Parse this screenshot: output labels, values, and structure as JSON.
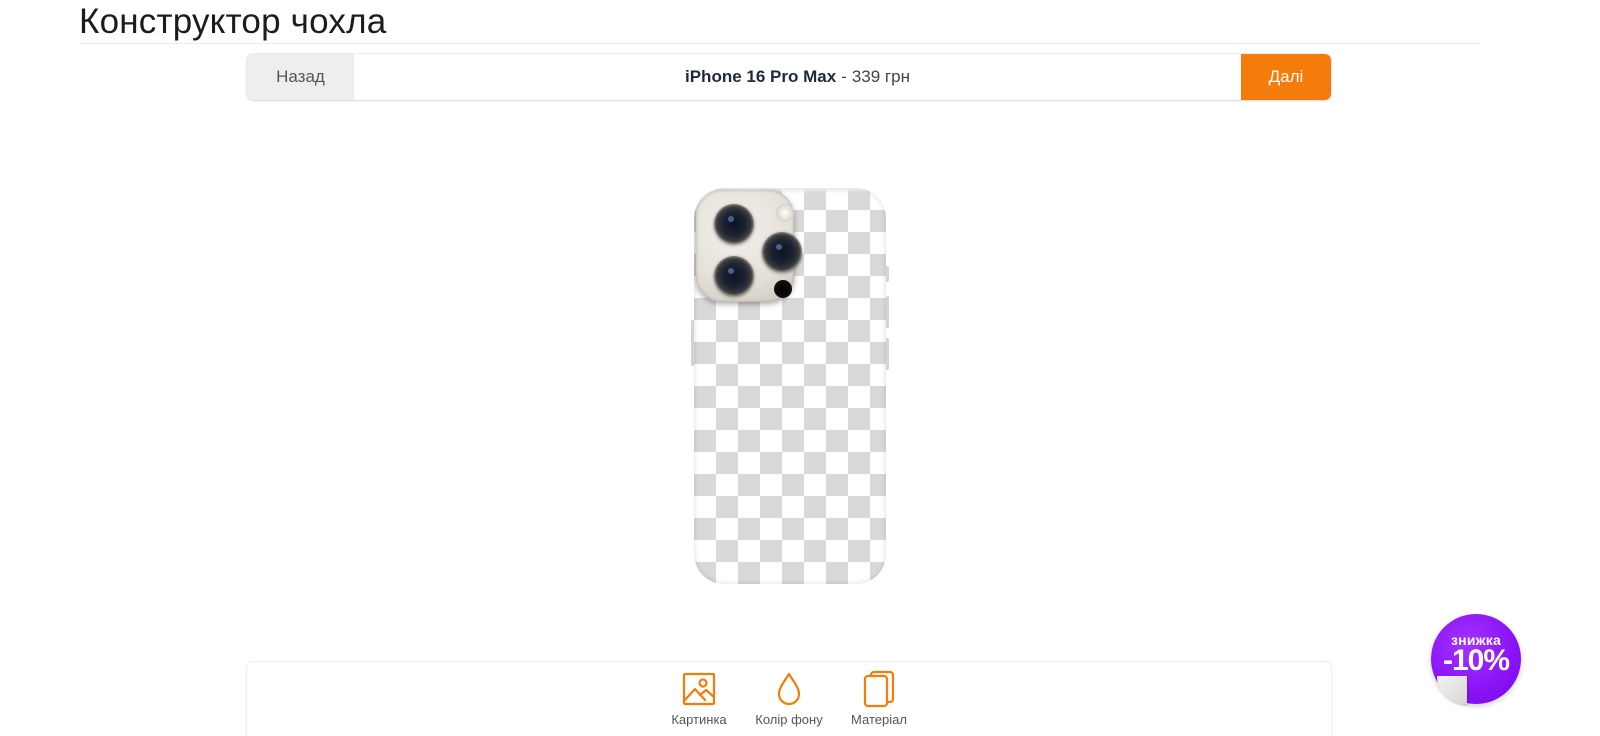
{
  "page": {
    "title": "Конструктор чохла"
  },
  "step_bar": {
    "back_label": "Назад",
    "product_model": "iPhone 16 Pro Max",
    "separator": "-",
    "price": "339 грн",
    "next_label": "Далі"
  },
  "preview": {
    "device": "iPhone 16 Pro Max",
    "background": "transparent-checkerboard"
  },
  "toolbar": {
    "items": [
      {
        "label": "Картинка",
        "icon": "image-icon"
      },
      {
        "label": "Колір фону",
        "icon": "droplet-icon"
      },
      {
        "label": "Матеріал",
        "icon": "layers-icon"
      }
    ]
  },
  "promo": {
    "label": "знижка",
    "value": "-10%"
  },
  "colors": {
    "accent": "#f47c0a",
    "promo": "#8a12f5",
    "back_button_bg": "#eeeeee"
  }
}
